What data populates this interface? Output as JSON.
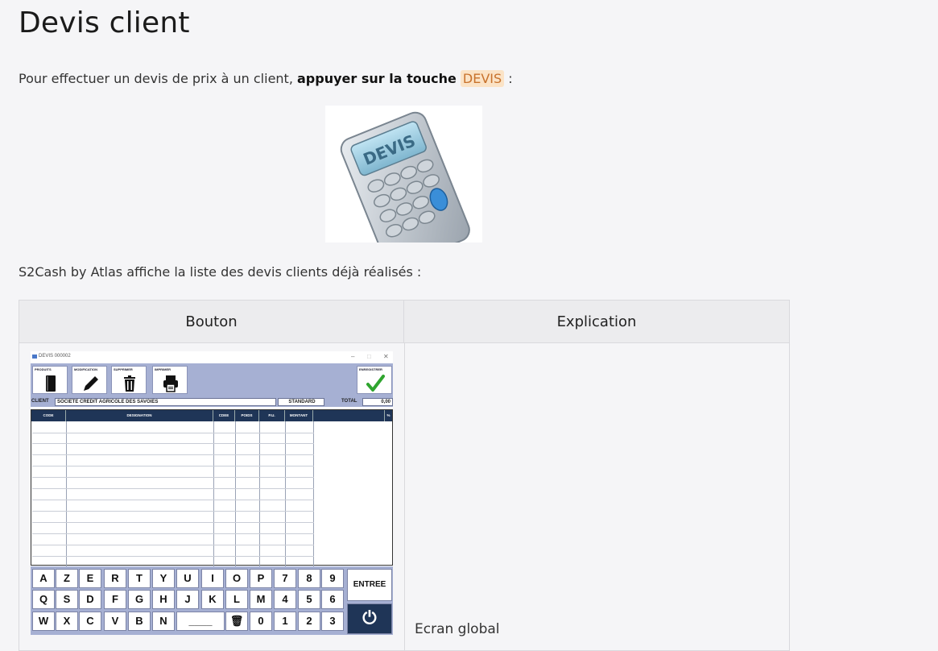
{
  "page": {
    "title": "Devis client",
    "intro_prefix": "Pour effectuer un devis de prix à un client, ",
    "intro_bold": "appuyer sur la touche",
    "intro_key": "DEVIS",
    "intro_suffix": " :",
    "list_intro": "S2Cash by Atlas affiche la liste des devis clients déjà réalisés :"
  },
  "calc_image": {
    "screen_text": "DEVIS"
  },
  "table": {
    "headers": [
      "Bouton",
      "Explication"
    ],
    "row_caption": "Ecran global"
  },
  "app": {
    "window_title": "DEVIS 000002",
    "window_controls": [
      "–",
      "□",
      "✕"
    ],
    "toolbar": {
      "produits": "PRODUITS",
      "modification": "MODIFICATION",
      "supprimer": "SUPPRIMER",
      "imprimer": "IMPRIMER",
      "enregistrer": "ENREGISTRER"
    },
    "client": {
      "label": "CLIENT",
      "name": "SOCIETE CREDIT AGRICOLE DES SAVOIES",
      "tarif": "STANDARD",
      "total_label": "TOTAL",
      "total_value": "0,00"
    },
    "grid_headers": [
      "CODE",
      "DESIGNATION",
      "CDEE",
      "POIDS",
      "P.U.",
      "MONTANT",
      "%"
    ],
    "keyboard": {
      "row1": [
        "A",
        "Z",
        "E",
        "R",
        "T",
        "Y",
        "U",
        "I",
        "O",
        "P",
        "7",
        "8",
        "9"
      ],
      "row2": [
        "Q",
        "S",
        "D",
        "F",
        "G",
        "H",
        "J",
        "K",
        "L",
        "M",
        "4",
        "5",
        "6"
      ],
      "row3": [
        "W",
        "X",
        "C",
        "V",
        "B",
        "N",
        "____",
        "🗑",
        "0",
        "1",
        "2",
        "3"
      ],
      "enter": "ENTREE",
      "power": "⏻"
    }
  },
  "colors": {
    "app_panel": "#a6b0d3",
    "grid_header": "#1f3557",
    "key_chip_bg": "#fbe3c6",
    "key_chip_text": "#c8722c",
    "check_green": "#2fa52f"
  }
}
